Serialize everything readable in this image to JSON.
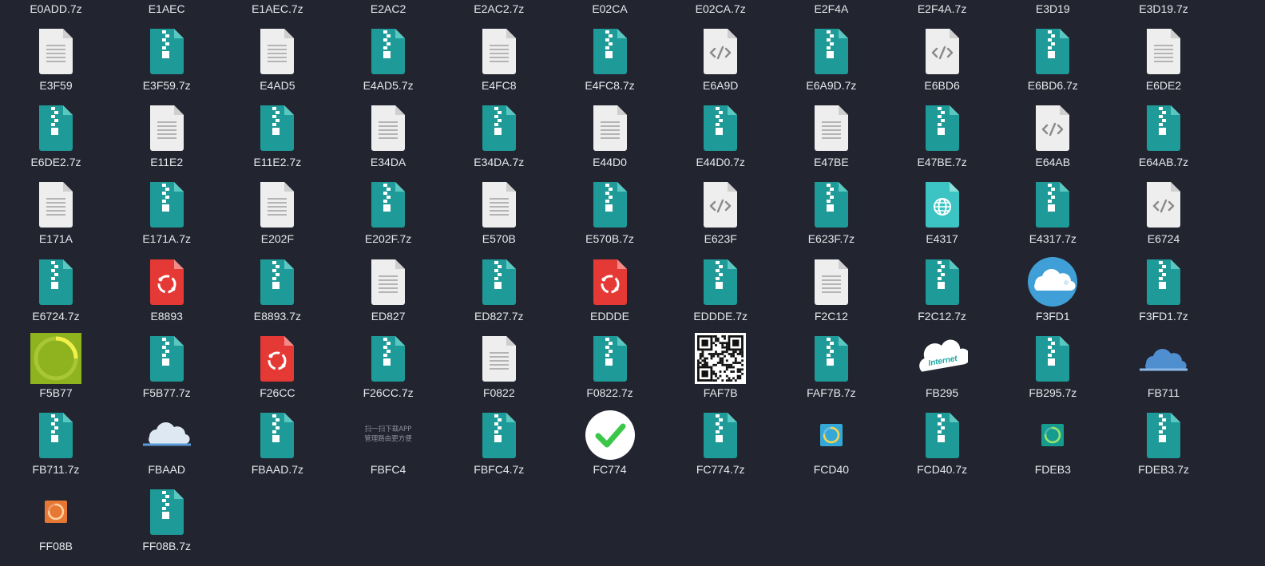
{
  "colors": {
    "background": "#222530",
    "label": "#e8e8ec",
    "archive": "#1e9a98",
    "archive_fold": "#5ac7c0",
    "document": "#eeeeee",
    "document_fold": "#cfcfcf",
    "red_app": "#e53935",
    "web": "#3cc3c3",
    "cloud_circle": "#3f9fd6",
    "check_green": "#3cc64a"
  },
  "top_row": [
    "E0ADD.7z",
    "E1AEC",
    "E1AEC.7z",
    "E2AC2",
    "E2AC2.7z",
    "E02CA",
    "E02CA.7z",
    "E2F4A",
    "E2F4A.7z",
    "E3D19",
    "E3D19.7z"
  ],
  "rows": [
    [
      {
        "name": "E3F59",
        "icon": "document-icon"
      },
      {
        "name": "E3F59.7z",
        "icon": "archive-icon"
      },
      {
        "name": "E4AD5",
        "icon": "document-icon"
      },
      {
        "name": "E4AD5.7z",
        "icon": "archive-icon"
      },
      {
        "name": "E4FC8",
        "icon": "document-icon"
      },
      {
        "name": "E4FC8.7z",
        "icon": "archive-icon"
      },
      {
        "name": "E6A9D",
        "icon": "code-file-icon"
      },
      {
        "name": "E6A9D.7z",
        "icon": "archive-icon"
      },
      {
        "name": "E6BD6",
        "icon": "code-file-icon"
      },
      {
        "name": "E6BD6.7z",
        "icon": "archive-icon"
      },
      {
        "name": "E6DE2",
        "icon": "document-icon"
      }
    ],
    [
      {
        "name": "E6DE2.7z",
        "icon": "archive-icon"
      },
      {
        "name": "E11E2",
        "icon": "document-icon"
      },
      {
        "name": "E11E2.7z",
        "icon": "archive-icon"
      },
      {
        "name": "E34DA",
        "icon": "document-icon"
      },
      {
        "name": "E34DA.7z",
        "icon": "archive-icon"
      },
      {
        "name": "E44D0",
        "icon": "document-icon"
      },
      {
        "name": "E44D0.7z",
        "icon": "archive-icon"
      },
      {
        "name": "E47BE",
        "icon": "document-icon"
      },
      {
        "name": "E47BE.7z",
        "icon": "archive-icon"
      },
      {
        "name": "E64AB",
        "icon": "code-file-icon"
      },
      {
        "name": "E64AB.7z",
        "icon": "archive-icon"
      }
    ],
    [
      {
        "name": "E171A",
        "icon": "document-icon"
      },
      {
        "name": "E171A.7z",
        "icon": "archive-icon"
      },
      {
        "name": "E202F",
        "icon": "document-icon"
      },
      {
        "name": "E202F.7z",
        "icon": "archive-icon"
      },
      {
        "name": "E570B",
        "icon": "document-icon"
      },
      {
        "name": "E570B.7z",
        "icon": "archive-icon"
      },
      {
        "name": "E623F",
        "icon": "code-file-icon"
      },
      {
        "name": "E623F.7z",
        "icon": "archive-icon"
      },
      {
        "name": "E4317",
        "icon": "web-file-icon"
      },
      {
        "name": "E4317.7z",
        "icon": "archive-icon"
      },
      {
        "name": "E6724",
        "icon": "code-file-icon"
      }
    ],
    [
      {
        "name": "E6724.7z",
        "icon": "archive-icon"
      },
      {
        "name": "E8893",
        "icon": "red-app-file-icon"
      },
      {
        "name": "E8893.7z",
        "icon": "archive-icon"
      },
      {
        "name": "ED827",
        "icon": "document-icon"
      },
      {
        "name": "ED827.7z",
        "icon": "archive-icon"
      },
      {
        "name": "EDDDE",
        "icon": "red-app-file-icon"
      },
      {
        "name": "EDDDE.7z",
        "icon": "archive-icon"
      },
      {
        "name": "F2C12",
        "icon": "document-icon"
      },
      {
        "name": "F2C12.7z",
        "icon": "archive-icon"
      },
      {
        "name": "F3FD1",
        "icon": "cloud-circle-icon"
      },
      {
        "name": "F3FD1.7z",
        "icon": "archive-icon"
      }
    ],
    [
      {
        "name": "F5B77",
        "icon": "loading-ring-green-icon"
      },
      {
        "name": "F5B77.7z",
        "icon": "archive-icon"
      },
      {
        "name": "F26CC",
        "icon": "red-app-file-icon"
      },
      {
        "name": "F26CC.7z",
        "icon": "archive-icon"
      },
      {
        "name": "F0822",
        "icon": "document-icon"
      },
      {
        "name": "F0822.7z",
        "icon": "archive-icon"
      },
      {
        "name": "FAF7B",
        "icon": "qr-code-icon"
      },
      {
        "name": "FAF7B.7z",
        "icon": "archive-icon"
      },
      {
        "name": "FB295",
        "icon": "internet-cloud-icon",
        "caption": "Internet"
      },
      {
        "name": "FB295.7z",
        "icon": "archive-icon"
      },
      {
        "name": "FB711",
        "icon": "blue-cloud-icon"
      }
    ],
    [
      {
        "name": "FB711.7z",
        "icon": "archive-icon"
      },
      {
        "name": "FBAAD",
        "icon": "white-cloud-icon"
      },
      {
        "name": "FBAAD.7z",
        "icon": "archive-icon"
      },
      {
        "name": "FBFC4",
        "icon": "scan-download-text-icon",
        "caption_lines": [
          "扫一扫下载APP",
          "管理路由更方便"
        ]
      },
      {
        "name": "FBFC4.7z",
        "icon": "archive-icon"
      },
      {
        "name": "FC774",
        "icon": "checkmark-circle-icon"
      },
      {
        "name": "FC774.7z",
        "icon": "archive-icon"
      },
      {
        "name": "FCD40",
        "icon": "loading-ring-blue-icon"
      },
      {
        "name": "FCD40.7z",
        "icon": "archive-icon"
      },
      {
        "name": "FDEB3",
        "icon": "loading-ring-teal-icon"
      },
      {
        "name": "FDEB3.7z",
        "icon": "archive-icon"
      }
    ],
    [
      {
        "name": "FF08B",
        "icon": "loading-ring-orange-icon"
      },
      {
        "name": "FF08B.7z",
        "icon": "archive-icon"
      }
    ]
  ]
}
